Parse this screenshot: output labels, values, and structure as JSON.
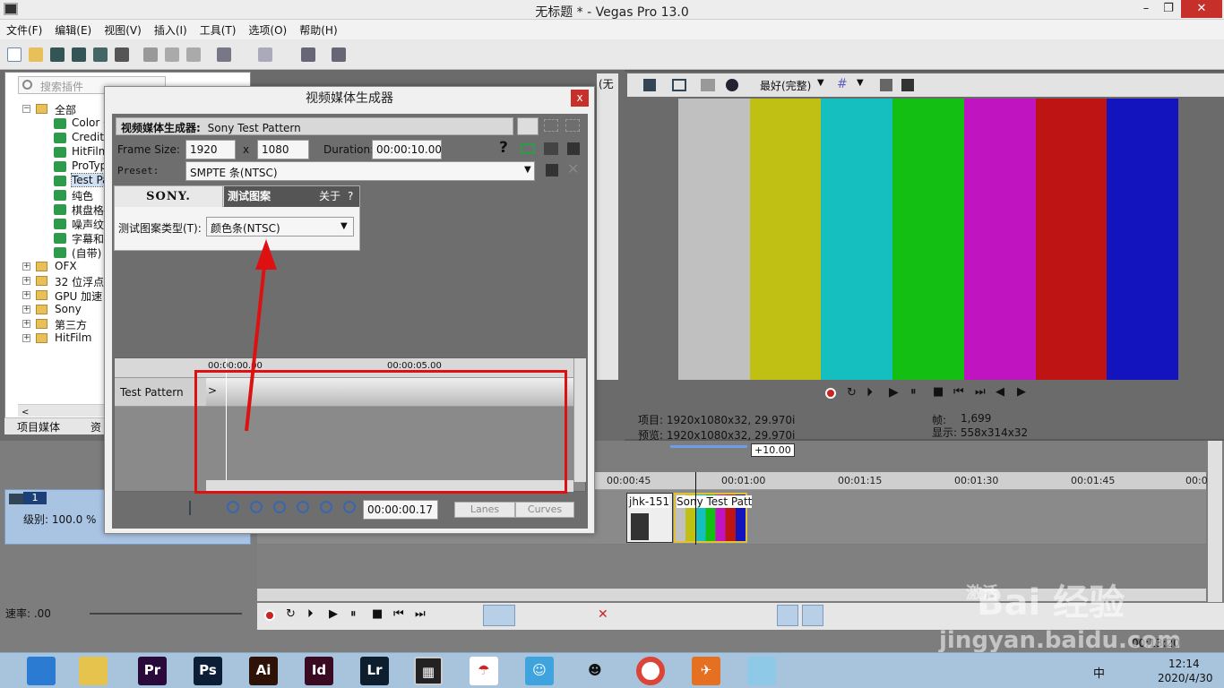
{
  "window": {
    "title": "无标题 * - Vegas Pro 13.0",
    "minimize": "–",
    "restore": "❐",
    "close": "✕"
  },
  "menu": [
    "文件(F)",
    "编辑(E)",
    "视图(V)",
    "插入(I)",
    "工具(T)",
    "选项(O)",
    "帮助(H)"
  ],
  "explorer": {
    "search_placeholder": "搜索插件",
    "tree": [
      {
        "label": "全部",
        "kind": "folder-open"
      },
      {
        "label": "Color C",
        "kind": "fx"
      },
      {
        "label": "Credit",
        "kind": "fx"
      },
      {
        "label": "HitFilm",
        "kind": "fx"
      },
      {
        "label": "ProTyp",
        "kind": "fx"
      },
      {
        "label": "Test Pa",
        "kind": "fx-selected"
      },
      {
        "label": "纯色",
        "kind": "fx"
      },
      {
        "label": "棋盘格",
        "kind": "fx"
      },
      {
        "label": "噪声纹",
        "kind": "fx"
      },
      {
        "label": "字幕和",
        "kind": "fx"
      },
      {
        "label": "(自带)",
        "kind": "fx"
      },
      {
        "label": "OFX",
        "kind": "folder"
      },
      {
        "label": "32 位浮点",
        "kind": "folder"
      },
      {
        "label": "GPU 加速",
        "kind": "folder"
      },
      {
        "label": "Sony",
        "kind": "folder"
      },
      {
        "label": "第三方",
        "kind": "folder"
      },
      {
        "label": "HitFilm",
        "kind": "folder"
      }
    ],
    "tabs": [
      "项目媒体",
      "资"
    ]
  },
  "preview": {
    "quality": "最好(完整)",
    "side_tab": "(无",
    "bars": [
      "#c0c0c0",
      "#bfbf14",
      "#15bfc0",
      "#14bf14",
      "#bf14bf",
      "#bf1414",
      "#1414bf"
    ],
    "info_project": "项目: 1920x1080x32, 29.970i",
    "info_preview": "预览: 1920x1080x32, 29.970i",
    "info_frame_label": "帧:",
    "info_frame_value": "1,699",
    "info_display": "显示: 558x314x32"
  },
  "timeline": {
    "zoom_label": "+10.00",
    "ruler": [
      "00:00:45",
      "00:01:00",
      "00:01:15",
      "00:01:30",
      "00:01:45",
      "00:0"
    ],
    "track_number": "1",
    "track_level": "级别: 100.0 %",
    "clip1_label": "jhk-151",
    "clip2_label": "Sony Test Patt",
    "rate_label": "速率: .00",
    "time_right": "00:13:20"
  },
  "dialog": {
    "title": "视频媒体生成器",
    "close": "x",
    "generator_label": "视频媒体生成器:",
    "generator_name": "Sony Test Pattern",
    "frame_size_label": "Frame Size:",
    "width": "1920",
    "x": "x",
    "height": "1080",
    "duration_label": "Duration:",
    "duration": "00:00:10.00",
    "preset_label": "Preset:",
    "preset": "SMPTE 条(NTSC)",
    "sony_tab": "SONY.",
    "pattern_tab": "测试图案",
    "about": "关于",
    "help": "?",
    "pattern_type_label": "测试图案类型(T):",
    "pattern_type": "颜色条(NTSC)",
    "kf_ruler_start": "00:00:00.00",
    "kf_ruler_mid": "00:00:05.00",
    "kf_row_label": "Test Pattern",
    "kf_time": "00:00:00.17",
    "lanes": "Lanes",
    "curves": "Curves"
  },
  "taskbar": {
    "apps": [
      {
        "label": "",
        "color": "#2a7bd1"
      },
      {
        "label": "",
        "color": "#e6c34c"
      },
      {
        "label": "Pr",
        "color": "#2a0a3a"
      },
      {
        "label": "Ps",
        "color": "#0b1e35"
      },
      {
        "label": "Ai",
        "color": "#2e1205"
      },
      {
        "label": "Id",
        "color": "#3a0a22"
      },
      {
        "label": "Lr",
        "color": "#0d1e2e"
      }
    ],
    "time": "12:14",
    "date": "2020/4/30",
    "ime": "中"
  },
  "watermark": {
    "brand": "Bai 经验",
    "url": "jingyan.baidu.com",
    "activate": "激活"
  }
}
